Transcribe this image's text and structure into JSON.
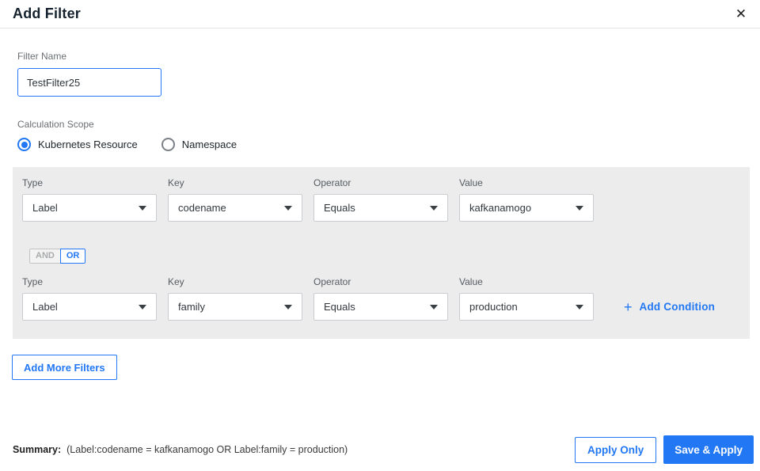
{
  "dialog": {
    "title": "Add Filter",
    "close_icon": "✕"
  },
  "filter_name": {
    "label": "Filter Name",
    "value": "TestFilter25"
  },
  "calculation_scope": {
    "label": "Calculation Scope",
    "options": [
      {
        "label": "Kubernetes Resource",
        "selected": true
      },
      {
        "label": "Namespace",
        "selected": false
      }
    ]
  },
  "conditions": {
    "logic_toggle": {
      "and_label": "AND",
      "or_label": "OR",
      "selected": "OR"
    },
    "add_condition": {
      "plus_icon": "+",
      "label": "Add Condition"
    },
    "rows": [
      {
        "type": {
          "label": "Type",
          "value": "Label"
        },
        "key": {
          "label": "Key",
          "value": "codename"
        },
        "operator": {
          "label": "Operator",
          "value": "Equals"
        },
        "value": {
          "label": "Value",
          "value": "kafkanamogo"
        }
      },
      {
        "type": {
          "label": "Type",
          "value": "Label"
        },
        "key": {
          "label": "Key",
          "value": "family"
        },
        "operator": {
          "label": "Operator",
          "value": "Equals"
        },
        "value": {
          "label": "Value",
          "value": "production"
        }
      }
    ]
  },
  "add_more_filters_label": "Add More Filters",
  "footer": {
    "summary_label": "Summary:",
    "summary_text": "(Label:codename = kafkanamogo OR Label:family = production)",
    "apply_only_label": "Apply Only",
    "save_apply_label": "Save & Apply"
  },
  "colors": {
    "accent": "#2277f4",
    "panel_bg": "#ececec"
  }
}
